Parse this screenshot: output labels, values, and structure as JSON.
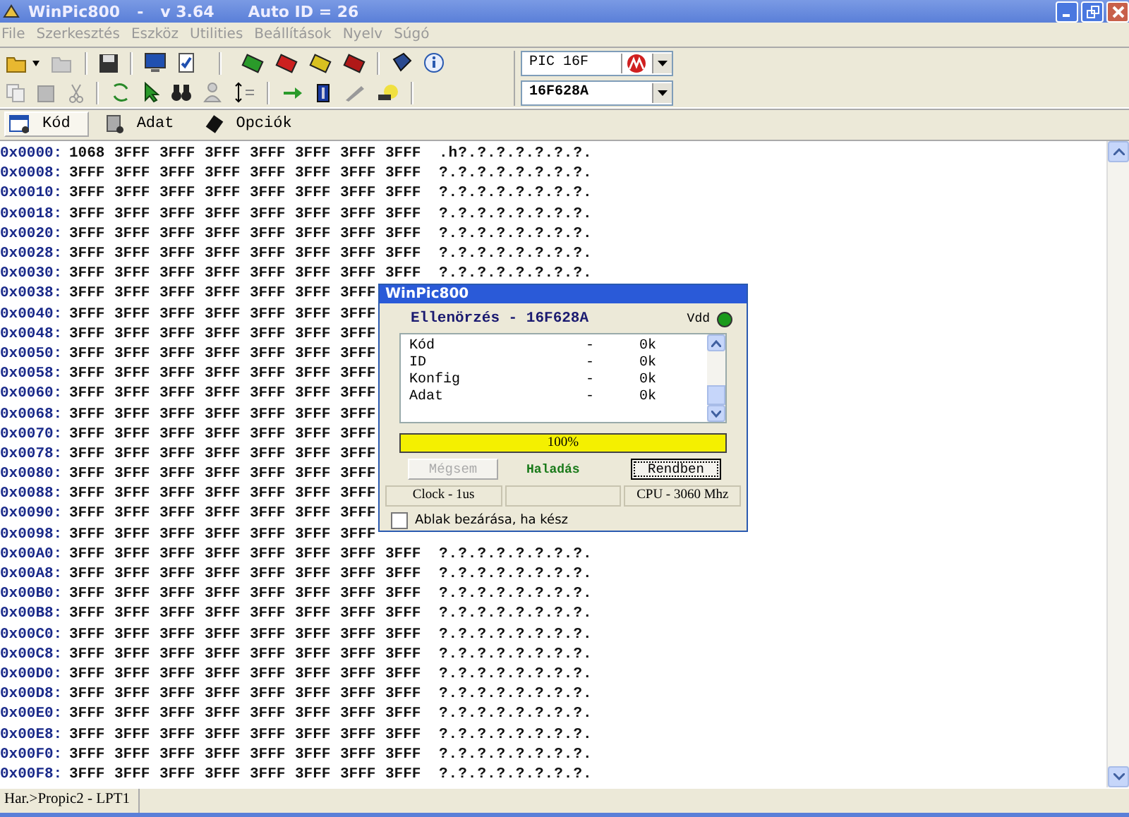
{
  "window": {
    "app": "WinPic800",
    "separator": "-",
    "version": "v 3.64",
    "auto_id": "Auto ID = 26"
  },
  "menu": [
    "File",
    "Szerkesztés",
    "Eszköz",
    "Utilities",
    "Beállítások",
    "Nyelv",
    "Súgó"
  ],
  "device": {
    "family": "PIC 16F",
    "model": "16F628A"
  },
  "tabs": [
    {
      "label": "Kód",
      "selected": true
    },
    {
      "label": "Adat",
      "selected": false
    },
    {
      "label": "Opciók",
      "selected": false
    }
  ],
  "hex_rows": [
    {
      "address": "0x0000:",
      "words": [
        "1068",
        "3FFF",
        "3FFF",
        "3FFF",
        "3FFF",
        "3FFF",
        "3FFF",
        "3FFF"
      ],
      "ascii": ".h?.?.?.?.?.?.?."
    },
    {
      "address": "0x0008:",
      "words": [
        "3FFF",
        "3FFF",
        "3FFF",
        "3FFF",
        "3FFF",
        "3FFF",
        "3FFF",
        "3FFF"
      ],
      "ascii": "?.?.?.?.?.?.?.?."
    },
    {
      "address": "0x0010:",
      "words": [
        "3FFF",
        "3FFF",
        "3FFF",
        "3FFF",
        "3FFF",
        "3FFF",
        "3FFF",
        "3FFF"
      ],
      "ascii": "?.?.?.?.?.?.?.?."
    },
    {
      "address": "0x0018:",
      "words": [
        "3FFF",
        "3FFF",
        "3FFF",
        "3FFF",
        "3FFF",
        "3FFF",
        "3FFF",
        "3FFF"
      ],
      "ascii": "?.?.?.?.?.?.?.?."
    },
    {
      "address": "0x0020:",
      "words": [
        "3FFF",
        "3FFF",
        "3FFF",
        "3FFF",
        "3FFF",
        "3FFF",
        "3FFF",
        "3FFF"
      ],
      "ascii": "?.?.?.?.?.?.?.?."
    },
    {
      "address": "0x0028:",
      "words": [
        "3FFF",
        "3FFF",
        "3FFF",
        "3FFF",
        "3FFF",
        "3FFF",
        "3FFF",
        "3FFF"
      ],
      "ascii": "?.?.?.?.?.?.?.?."
    },
    {
      "address": "0x0030:",
      "words": [
        "3FFF",
        "3FFF",
        "3FFF",
        "3FFF",
        "3FFF",
        "3FFF",
        "3FFF",
        "3FFF"
      ],
      "ascii": "?.?.?.?.?.?.?.?."
    },
    {
      "address": "0x0038:",
      "words": [
        "3FFF",
        "3FFF",
        "3FFF",
        "3FFF",
        "3FFF",
        "3FFF",
        "3FFF"
      ]
    },
    {
      "address": "0x0040:",
      "words": [
        "3FFF",
        "3FFF",
        "3FFF",
        "3FFF",
        "3FFF",
        "3FFF",
        "3FFF"
      ]
    },
    {
      "address": "0x0048:",
      "words": [
        "3FFF",
        "3FFF",
        "3FFF",
        "3FFF",
        "3FFF",
        "3FFF",
        "3FFF"
      ]
    },
    {
      "address": "0x0050:",
      "words": [
        "3FFF",
        "3FFF",
        "3FFF",
        "3FFF",
        "3FFF",
        "3FFF",
        "3FFF"
      ]
    },
    {
      "address": "0x0058:",
      "words": [
        "3FFF",
        "3FFF",
        "3FFF",
        "3FFF",
        "3FFF",
        "3FFF",
        "3FFF"
      ]
    },
    {
      "address": "0x0060:",
      "words": [
        "3FFF",
        "3FFF",
        "3FFF",
        "3FFF",
        "3FFF",
        "3FFF",
        "3FFF"
      ]
    },
    {
      "address": "0x0068:",
      "words": [
        "3FFF",
        "3FFF",
        "3FFF",
        "3FFF",
        "3FFF",
        "3FFF",
        "3FFF"
      ]
    },
    {
      "address": "0x0070:",
      "words": [
        "3FFF",
        "3FFF",
        "3FFF",
        "3FFF",
        "3FFF",
        "3FFF",
        "3FFF"
      ]
    },
    {
      "address": "0x0078:",
      "words": [
        "3FFF",
        "3FFF",
        "3FFF",
        "3FFF",
        "3FFF",
        "3FFF",
        "3FFF"
      ]
    },
    {
      "address": "0x0080:",
      "words": [
        "3FFF",
        "3FFF",
        "3FFF",
        "3FFF",
        "3FFF",
        "3FFF",
        "3FFF"
      ]
    },
    {
      "address": "0x0088:",
      "words": [
        "3FFF",
        "3FFF",
        "3FFF",
        "3FFF",
        "3FFF",
        "3FFF",
        "3FFF"
      ]
    },
    {
      "address": "0x0090:",
      "words": [
        "3FFF",
        "3FFF",
        "3FFF",
        "3FFF",
        "3FFF",
        "3FFF",
        "3FFF"
      ]
    },
    {
      "address": "0x0098:",
      "words": [
        "3FFF",
        "3FFF",
        "3FFF",
        "3FFF",
        "3FFF",
        "3FFF",
        "3FFF"
      ]
    },
    {
      "address": "0x00A0:",
      "words": [
        "3FFF",
        "3FFF",
        "3FFF",
        "3FFF",
        "3FFF",
        "3FFF",
        "3FFF",
        "3FFF"
      ],
      "ascii": "?.?.?.?.?.?.?.?."
    },
    {
      "address": "0x00A8:",
      "words": [
        "3FFF",
        "3FFF",
        "3FFF",
        "3FFF",
        "3FFF",
        "3FFF",
        "3FFF",
        "3FFF"
      ],
      "ascii": "?.?.?.?.?.?.?.?."
    },
    {
      "address": "0x00B0:",
      "words": [
        "3FFF",
        "3FFF",
        "3FFF",
        "3FFF",
        "3FFF",
        "3FFF",
        "3FFF",
        "3FFF"
      ],
      "ascii": "?.?.?.?.?.?.?.?."
    },
    {
      "address": "0x00B8:",
      "words": [
        "3FFF",
        "3FFF",
        "3FFF",
        "3FFF",
        "3FFF",
        "3FFF",
        "3FFF",
        "3FFF"
      ],
      "ascii": "?.?.?.?.?.?.?.?."
    },
    {
      "address": "0x00C0:",
      "words": [
        "3FFF",
        "3FFF",
        "3FFF",
        "3FFF",
        "3FFF",
        "3FFF",
        "3FFF",
        "3FFF"
      ],
      "ascii": "?.?.?.?.?.?.?.?."
    },
    {
      "address": "0x00C8:",
      "words": [
        "3FFF",
        "3FFF",
        "3FFF",
        "3FFF",
        "3FFF",
        "3FFF",
        "3FFF",
        "3FFF"
      ],
      "ascii": "?.?.?.?.?.?.?.?."
    },
    {
      "address": "0x00D0:",
      "words": [
        "3FFF",
        "3FFF",
        "3FFF",
        "3FFF",
        "3FFF",
        "3FFF",
        "3FFF",
        "3FFF"
      ],
      "ascii": "?.?.?.?.?.?.?.?."
    },
    {
      "address": "0x00D8:",
      "words": [
        "3FFF",
        "3FFF",
        "3FFF",
        "3FFF",
        "3FFF",
        "3FFF",
        "3FFF",
        "3FFF"
      ],
      "ascii": "?.?.?.?.?.?.?.?."
    },
    {
      "address": "0x00E0:",
      "words": [
        "3FFF",
        "3FFF",
        "3FFF",
        "3FFF",
        "3FFF",
        "3FFF",
        "3FFF",
        "3FFF"
      ],
      "ascii": "?.?.?.?.?.?.?.?."
    },
    {
      "address": "0x00E8:",
      "words": [
        "3FFF",
        "3FFF",
        "3FFF",
        "3FFF",
        "3FFF",
        "3FFF",
        "3FFF",
        "3FFF"
      ],
      "ascii": "?.?.?.?.?.?.?.?."
    },
    {
      "address": "0x00F0:",
      "words": [
        "3FFF",
        "3FFF",
        "3FFF",
        "3FFF",
        "3FFF",
        "3FFF",
        "3FFF",
        "3FFF"
      ],
      "ascii": "?.?.?.?.?.?.?.?."
    },
    {
      "address": "0x00F8:",
      "words": [
        "3FFF",
        "3FFF",
        "3FFF",
        "3FFF",
        "3FFF",
        "3FFF",
        "3FFF",
        "3FFF"
      ],
      "ascii": "?.?.?.?.?.?.?.?."
    }
  ],
  "dialog": {
    "title": "WinPic800",
    "heading": "Ellenörzés - 16F628A",
    "vdd_label": "Vdd",
    "vdd_on": true,
    "results": [
      {
        "item": "Kód",
        "dash": "-",
        "status": "0k"
      },
      {
        "item": "ID",
        "dash": "-",
        "status": "0k"
      },
      {
        "item": "Konfig",
        "dash": "-",
        "status": "0k"
      },
      {
        "item": "Adat",
        "dash": "-",
        "status": "0k"
      }
    ],
    "progress": {
      "level": 1,
      "label": "100%"
    },
    "cancel_button": {
      "label": "Mégsem",
      "disabled": true
    },
    "state_label": "Haladás",
    "ok_button": {
      "label": "Rendben",
      "disabled": false
    },
    "clock_panel": "Clock - 1us",
    "cpu_panel": "CPU - 3060 Mhz",
    "close_when_done": {
      "label": "Ablak bezárása, ha kész",
      "checked": false
    }
  },
  "status_bar": {
    "port": "Har.>Propic2 - LPT1"
  }
}
